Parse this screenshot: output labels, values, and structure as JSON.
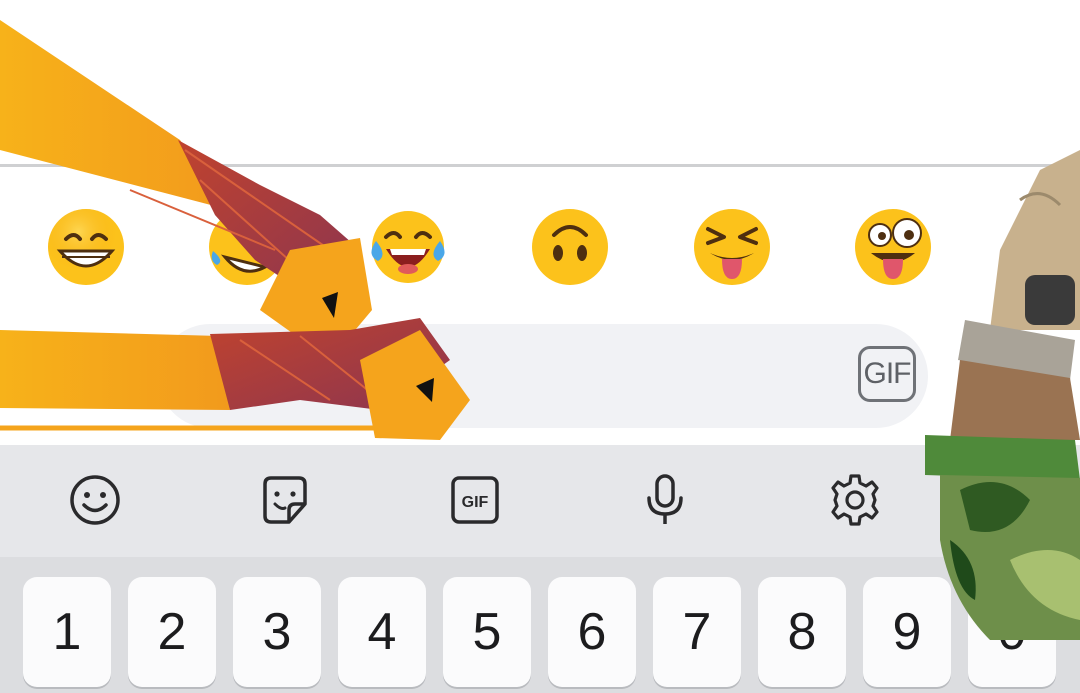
{
  "composer": {
    "placeholder": "",
    "gif_label": "GIF"
  },
  "emoji_suggestions": [
    {
      "name": "grinning-face-with-smiling-eyes"
    },
    {
      "name": "rolling-on-the-floor-laughing"
    },
    {
      "name": "face-with-tears-of-joy"
    },
    {
      "name": "upside-down-face"
    },
    {
      "name": "squinting-face-with-tongue"
    },
    {
      "name": "zany-face"
    }
  ],
  "toolbar": {
    "gif_label": "GIF",
    "icons": [
      "smiley-icon",
      "sticker-icon",
      "gif-icon",
      "microphone-icon",
      "gear-icon"
    ]
  },
  "keyboard": {
    "number_row": [
      "1",
      "2",
      "3",
      "4",
      "5",
      "6",
      "7",
      "8",
      "9",
      "0"
    ]
  },
  "colors": {
    "arm_orange": "#f5a623",
    "wrap_maroon": "#a23a4b",
    "glove_tan": "#c4b08e",
    "camo_green": "#2f6b2a"
  }
}
